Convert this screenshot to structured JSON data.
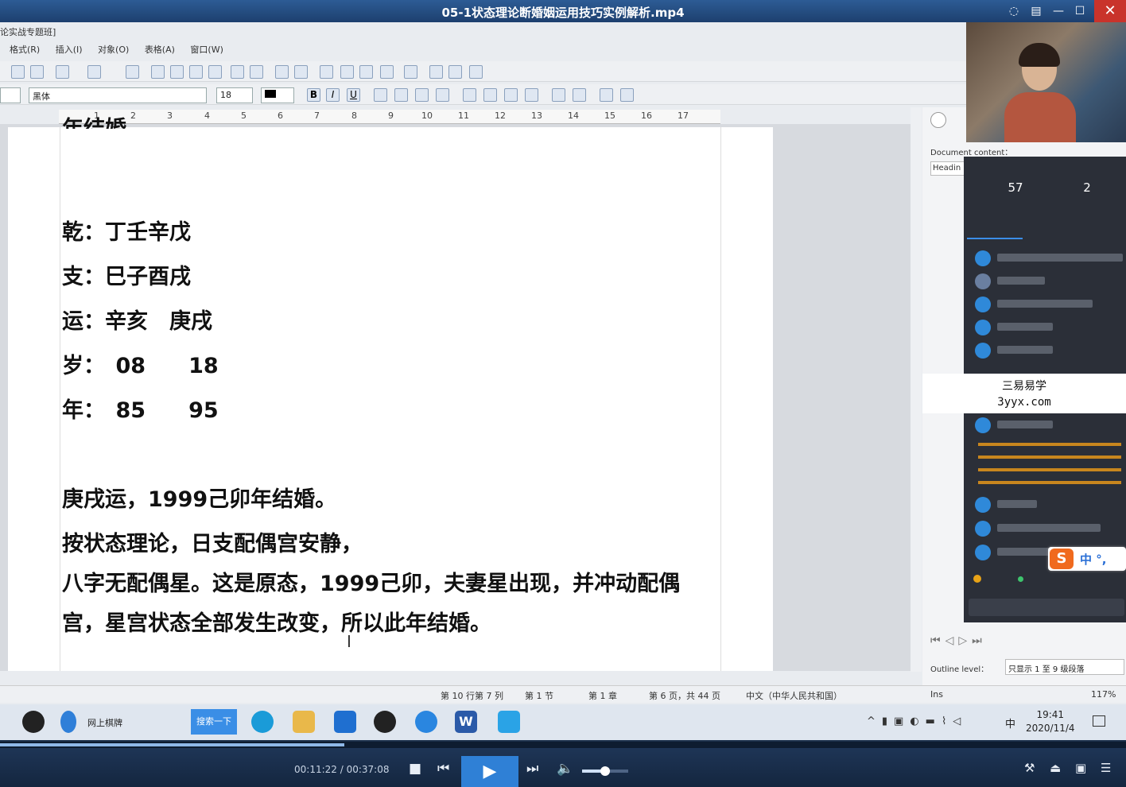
{
  "player": {
    "title": "05-1状态理论断婚姻运用技巧实例解析.mp4",
    "time": "00:11:22 / 00:37:08",
    "progress": 0.306,
    "volume": 0.5
  },
  "word": {
    "doc_title_fragment": "论实战专题班]",
    "menu": [
      "格式(R)",
      "插入(I)",
      "对象(O)",
      "表格(A)",
      "窗口(W)"
    ],
    "font_name": "黑体",
    "font_size": "18",
    "ruler_numbers": [
      "1",
      "2",
      "3",
      "4",
      "5",
      "6",
      "7",
      "8",
      "9",
      "10",
      "11",
      "12",
      "13",
      "14",
      "15",
      "16",
      "17"
    ],
    "document_lines": [
      "年结婚。",
      "乾：丁壬辛戊",
      "支：巳子酉戌",
      "运：辛亥　庚戌",
      "岁：　08　　18",
      "年：　85　　95",
      "庚戌运，1999己卯年结婚。",
      "按状态理论，日支配偶宫安静，",
      "八字无配偶星。这是原态，1999己卯，夫妻星出现，并冲动配偶",
      "宫，星宫状态全部发生改变，所以此年结婚。"
    ],
    "statusbar": {
      "position": "第 10 行第 7 列",
      "section": "第 1 节",
      "chapter": "第 1 章",
      "page": "第 6 页，共 44 页",
      "language": "中文（中华人民共和国）",
      "mode": "Ins",
      "zoom": "117%"
    }
  },
  "sidepanel": {
    "document_content_label": "Document content：",
    "heading_label": "Headin",
    "outline_label": "Outline level：",
    "outline_value": "只显示 1 至 9 级段落"
  },
  "live": {
    "stat1_value": "57",
    "stat2_value": "2"
  },
  "watermark": {
    "line1": "三易易学",
    "line2": "3yyx.com"
  },
  "ime": {
    "label": "中 °,"
  },
  "taskbar": {
    "browser_label": "网上棋牌",
    "search_label": "搜索一下",
    "ime_indicator": "中",
    "clock_time": "19:41",
    "clock_date": "2020/11/4"
  }
}
